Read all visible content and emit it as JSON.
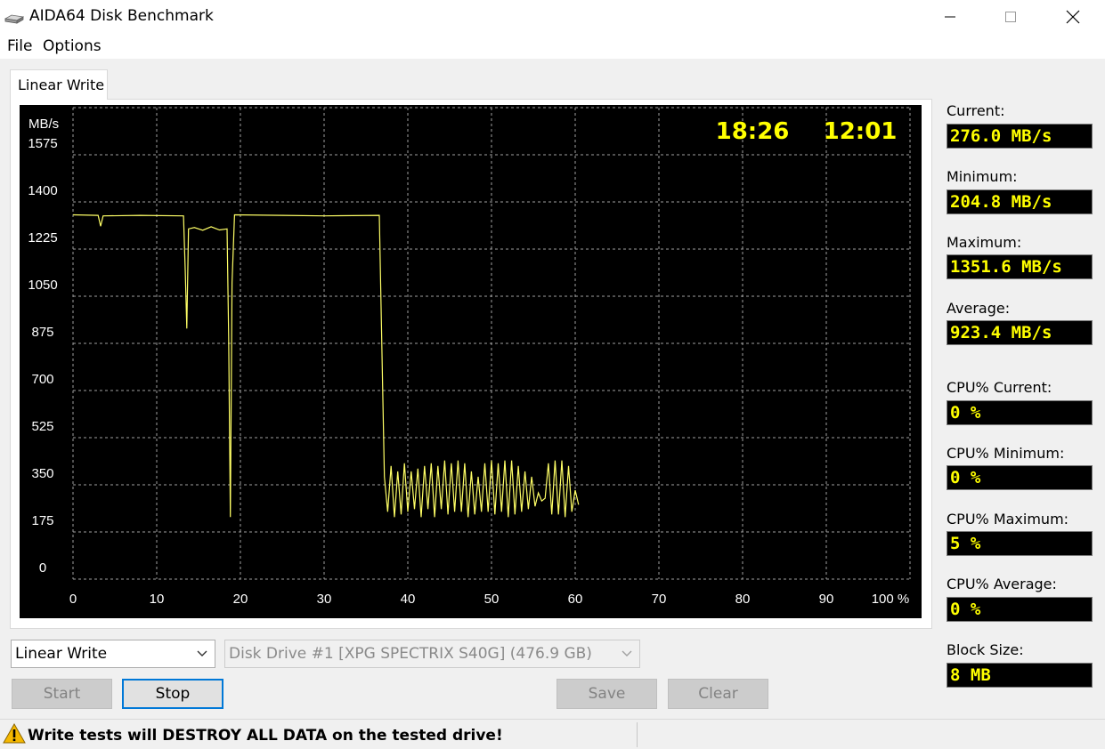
{
  "window": {
    "title": "AIDA64 Disk Benchmark",
    "icons": [
      "drive-icon",
      "minimize-icon",
      "maximize-icon",
      "close-icon"
    ]
  },
  "menu": {
    "file": "File",
    "options": "Options"
  },
  "tab": {
    "label": "Linear Write"
  },
  "chart": {
    "elapsed_time": "18:26",
    "remaining_time": "12:01",
    "y_unit": "MB/s",
    "colors": {
      "background": "#000000",
      "grid": "#a0a0a0",
      "line": "#ffff66",
      "time_text": "#ffff00",
      "axis_text": "#ffffff"
    }
  },
  "chart_data": {
    "type": "line",
    "ylabel": "MB/s",
    "xlabel": "",
    "x_tick_labels": [
      "0",
      "10",
      "20",
      "30",
      "40",
      "50",
      "60",
      "70",
      "80",
      "90",
      "100 %"
    ],
    "y_tick_labels": [
      "0",
      "175",
      "350",
      "525",
      "700",
      "875",
      "1050",
      "1225",
      "1400",
      "1575"
    ],
    "xlim": [
      0,
      100
    ],
    "ylim": [
      0,
      1750
    ],
    "grid": true,
    "series": [
      {
        "values": [
          [
            0,
            1352
          ],
          [
            3,
            1350
          ],
          [
            3.3,
            1310
          ],
          [
            3.6,
            1348
          ],
          [
            8,
            1350
          ],
          [
            13.2,
            1348
          ],
          [
            13.4,
            1150
          ],
          [
            13.6,
            930
          ],
          [
            13.8,
            1300
          ],
          [
            14.5,
            1305
          ],
          [
            15.5,
            1295
          ],
          [
            16.5,
            1308
          ],
          [
            17.5,
            1296
          ],
          [
            18.4,
            1300
          ],
          [
            18.6,
            900
          ],
          [
            18.8,
            230
          ],
          [
            19.0,
            1100
          ],
          [
            19.3,
            1352
          ],
          [
            25,
            1350
          ],
          [
            30,
            1348
          ],
          [
            36.6,
            1350
          ],
          [
            37.0,
            700
          ],
          [
            37.2,
            380
          ],
          [
            37.6,
            250
          ],
          [
            38,
            420
          ],
          [
            38.4,
            230
          ],
          [
            38.8,
            400
          ],
          [
            39.2,
            240
          ],
          [
            39.6,
            430
          ],
          [
            40,
            250
          ],
          [
            40.4,
            400
          ],
          [
            40.8,
            260
          ],
          [
            41.2,
            410
          ],
          [
            41.6,
            230
          ],
          [
            42,
            420
          ],
          [
            42.4,
            260
          ],
          [
            42.8,
            430
          ],
          [
            43.2,
            230
          ],
          [
            43.6,
            420
          ],
          [
            44,
            260
          ],
          [
            44.4,
            440
          ],
          [
            44.8,
            240
          ],
          [
            45.2,
            430
          ],
          [
            45.6,
            250
          ],
          [
            46,
            440
          ],
          [
            46.4,
            250
          ],
          [
            46.8,
            430
          ],
          [
            47.2,
            230
          ],
          [
            47.6,
            400
          ],
          [
            48,
            240
          ],
          [
            48.4,
            380
          ],
          [
            48.8,
            250
          ],
          [
            49.2,
            430
          ],
          [
            49.6,
            250
          ],
          [
            50,
            440
          ],
          [
            50.4,
            240
          ],
          [
            50.8,
            430
          ],
          [
            51.2,
            250
          ],
          [
            51.6,
            440
          ],
          [
            52,
            230
          ],
          [
            52.4,
            440
          ],
          [
            52.8,
            240
          ],
          [
            53.2,
            420
          ],
          [
            53.6,
            250
          ],
          [
            54,
            400
          ],
          [
            54.4,
            260
          ],
          [
            54.8,
            380
          ],
          [
            55.2,
            270
          ],
          [
            55.6,
            320
          ],
          [
            56,
            290
          ],
          [
            56.4,
            300
          ],
          [
            56.8,
            430
          ],
          [
            57.2,
            240
          ],
          [
            57.6,
            440
          ],
          [
            58,
            240
          ],
          [
            58.4,
            440
          ],
          [
            58.8,
            230
          ],
          [
            59.2,
            420
          ],
          [
            59.6,
            250
          ],
          [
            60,
            330
          ],
          [
            60.4,
            276
          ]
        ]
      }
    ]
  },
  "stats": {
    "current": {
      "label": "Current:",
      "value": "276.0 MB/s"
    },
    "minimum": {
      "label": "Minimum:",
      "value": "204.8 MB/s"
    },
    "maximum": {
      "label": "Maximum:",
      "value": "1351.6 MB/s"
    },
    "average": {
      "label": "Average:",
      "value": "923.4 MB/s"
    },
    "cpu_current": {
      "label": "CPU% Current:",
      "value": "0 %"
    },
    "cpu_minimum": {
      "label": "CPU% Minimum:",
      "value": "0 %"
    },
    "cpu_maximum": {
      "label": "CPU% Maximum:",
      "value": "5 %"
    },
    "cpu_average": {
      "label": "CPU% Average:",
      "value": "0 %"
    },
    "block_size": {
      "label": "Block Size:",
      "value": "8 MB"
    }
  },
  "controls": {
    "test_select": "Linear Write",
    "drive_select": "Disk Drive #1  [XPG SPECTRIX S40G]  (476.9 GB)",
    "start": "Start",
    "stop": "Stop",
    "save": "Save",
    "clear": "Clear"
  },
  "status": {
    "warning": "Write tests will DESTROY ALL DATA on the tested drive!",
    "icon": "warning-icon"
  }
}
